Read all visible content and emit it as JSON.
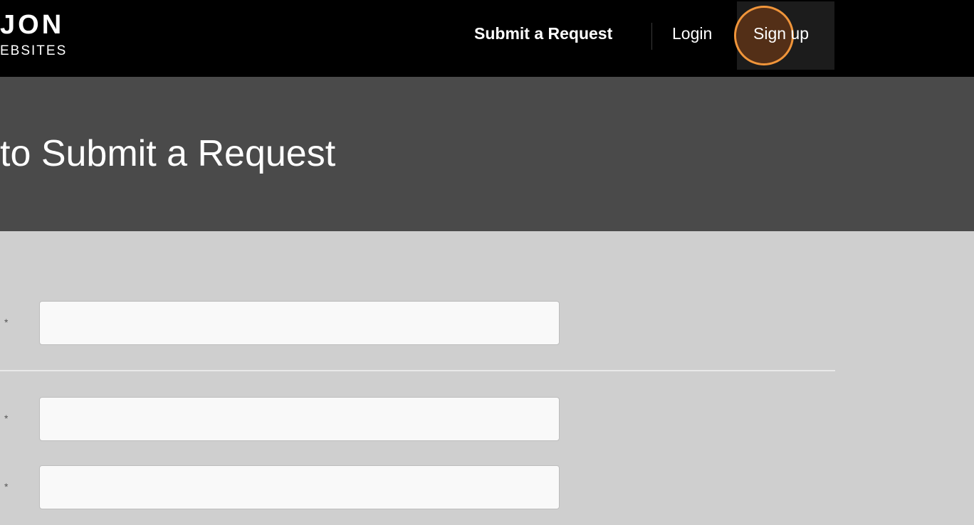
{
  "header": {
    "logo": {
      "main": "JON",
      "sub": "EBSITES"
    },
    "nav": {
      "submit_label": "Submit a Request",
      "login_label": "Login",
      "signup_label": "Sign up"
    }
  },
  "hero": {
    "title": "to Submit a Request"
  },
  "form": {
    "required_marker": "*",
    "fields": [
      {
        "value": "",
        "placeholder": ""
      },
      {
        "value": "",
        "placeholder": ""
      },
      {
        "value": "",
        "placeholder": ""
      }
    ]
  },
  "colors": {
    "topbar": "#000000",
    "hero": "#4a4a4a",
    "form_background": "#cfcfcf",
    "click_highlight": "#f0953a"
  }
}
